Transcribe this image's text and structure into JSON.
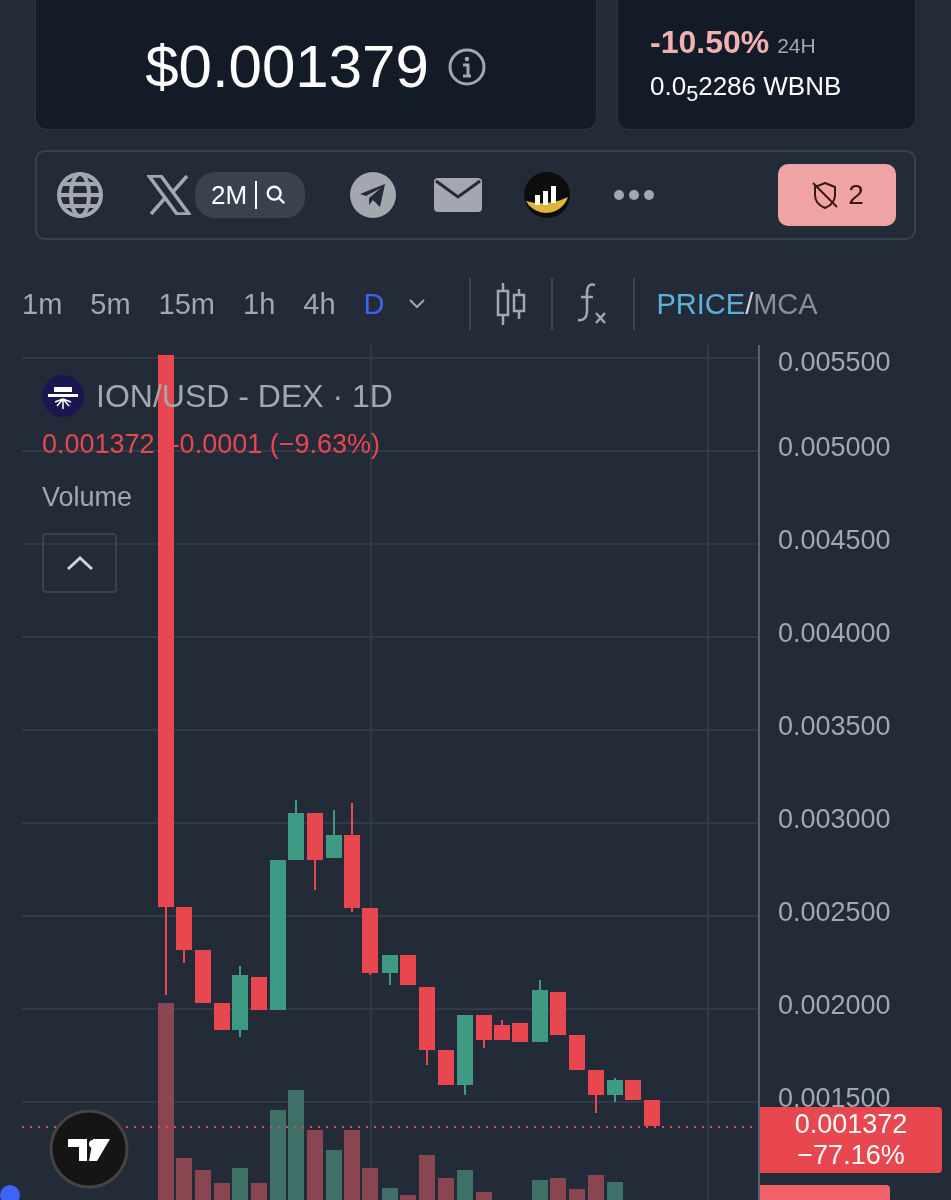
{
  "price_card": {
    "price": "$0.001379"
  },
  "change_card": {
    "change": "-10.50%",
    "period": "24H",
    "quote_price": "0.0$_{5}$2286 WBNB"
  },
  "social_bar": {
    "followers": "2M",
    "audit_button": {
      "count": "2"
    }
  },
  "timeframes": [
    {
      "label": "1m",
      "selected": false
    },
    {
      "label": "5m",
      "selected": false
    },
    {
      "label": "15m",
      "selected": false
    },
    {
      "label": "1h",
      "selected": false
    },
    {
      "label": "4h",
      "selected": false
    },
    {
      "label": "D",
      "selected": true
    }
  ],
  "price_mode": {
    "price": "PRICE",
    "separator": "/",
    "mcap": "MCA"
  },
  "chart": {
    "symbol": "ION/USD - DEX · 1D",
    "last": "0.001372",
    "change": "-0.0001 (−9.63%)",
    "volume_label": "Volume",
    "price_ticks": [
      "0.005500",
      "0.005000",
      "0.004500",
      "0.004000",
      "0.003500",
      "0.003000",
      "0.002500",
      "0.002000",
      "0.001500"
    ],
    "last_price_tag": {
      "price": "0.001372",
      "change": "−77.16%"
    }
  }
}
